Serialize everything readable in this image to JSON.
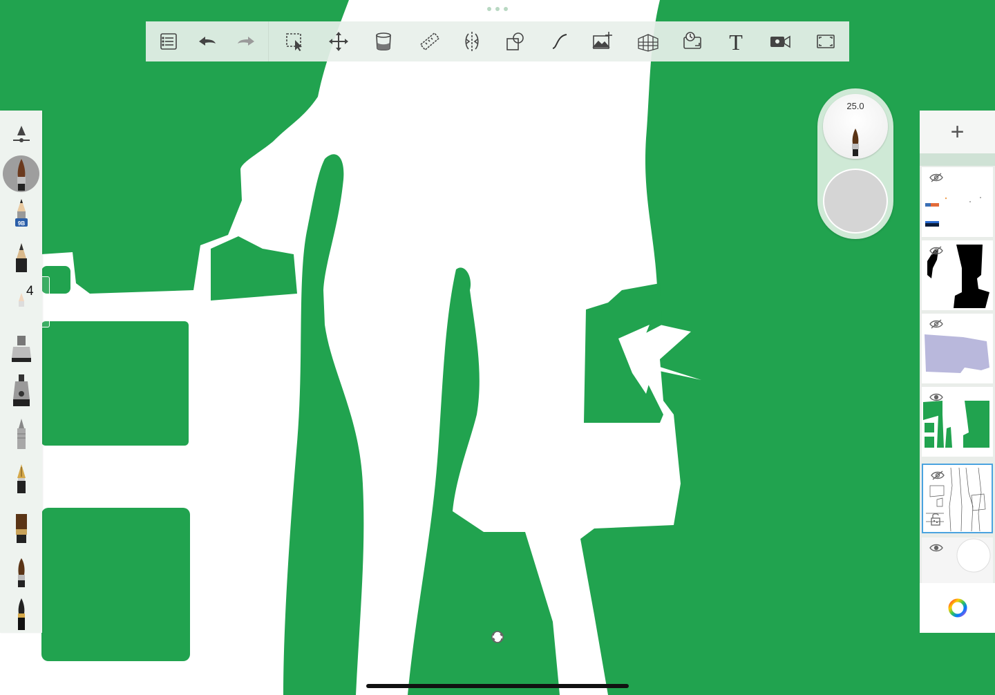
{
  "app": {
    "canvas_color": "#21a34f",
    "background_color": "#ffffff"
  },
  "toolbar": {
    "tools": [
      {
        "name": "layers-list-icon"
      },
      {
        "name": "undo-icon"
      },
      {
        "name": "redo-icon"
      },
      {
        "name": "selection-icon"
      },
      {
        "name": "transform-icon"
      },
      {
        "name": "fill-bucket-icon"
      },
      {
        "name": "ruler-icon"
      },
      {
        "name": "symmetry-icon"
      },
      {
        "name": "shapes-icon"
      },
      {
        "name": "stroke-icon"
      },
      {
        "name": "add-image-icon"
      },
      {
        "name": "perspective-grid-icon"
      },
      {
        "name": "time-lapse-icon"
      },
      {
        "name": "text-icon"
      },
      {
        "name": "video-icon"
      },
      {
        "name": "fullscreen-icon"
      }
    ]
  },
  "brush_palette": {
    "brushes": [
      "brush-settings-icon",
      "paint-brush-icon",
      "pencil-9b-icon",
      "graphite-pencil-icon",
      "airbrush-icon",
      "marker-icon",
      "felt-tip-icon",
      "technical-pen-icon",
      "ink-pen-icon",
      "flat-brush-icon",
      "round-brush-icon",
      "calligraphy-brush-icon"
    ],
    "pencil_label": "9B",
    "size_badge": "4"
  },
  "puck": {
    "size_value": "25.0",
    "color": "#d5d5d5"
  },
  "layers": {
    "add_label": "+",
    "items": [
      {
        "name": "layer-1",
        "visible": false
      },
      {
        "name": "layer-2",
        "visible": false
      },
      {
        "name": "layer-3",
        "visible": false
      },
      {
        "name": "layer-4",
        "visible": true
      },
      {
        "name": "layer-5",
        "visible": false,
        "selected": true,
        "locked": true
      },
      {
        "name": "background-layer",
        "visible": true
      }
    ]
  }
}
